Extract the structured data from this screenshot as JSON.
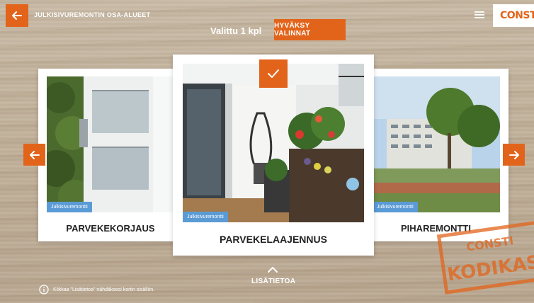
{
  "header": {
    "title": "JULKISIVUREMONTIN OSA-ALUEET",
    "logo_text": "CONSTI",
    "selected_count": "Valittu 1 kpl",
    "accept_label": "HYVÄKSY VALINNAT"
  },
  "cards": [
    {
      "label": "PARVEKEKORJAUS",
      "badge": "Julkisivuremontti"
    },
    {
      "label": "PARVEKELAAJENNUS",
      "badge": "Julkisivuremontti",
      "selected": true
    },
    {
      "label": "PIHAREMONTTI",
      "badge": "Julkisivuremontti"
    }
  ],
  "footer": {
    "more_info": "LISÄTIETOA",
    "hint": "Klikkaa \"Lisätietoa\" nähdäksesi kortin sisällön."
  },
  "stamp": {
    "line1": "CONSTI",
    "line2": "KODIKAS"
  },
  "colors": {
    "accent": "#e2641b",
    "badge": "#5b9bd5"
  },
  "icons": [
    "back-arrow-icon",
    "menu-icon",
    "check-icon",
    "chevron-left-icon",
    "chevron-right-icon",
    "chevron-up-icon",
    "info-icon"
  ]
}
